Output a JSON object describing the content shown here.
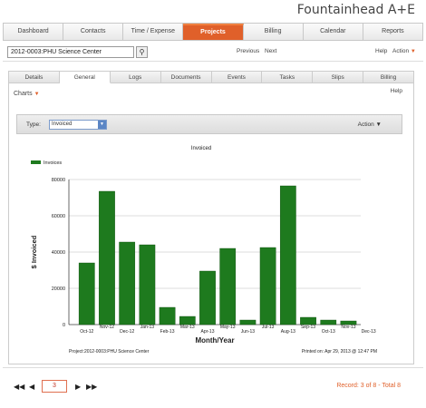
{
  "app": {
    "title": "Fountainhead A+E"
  },
  "main_tabs": [
    {
      "label": "Dashboard"
    },
    {
      "label": "Contacts"
    },
    {
      "label": "Time / Expense"
    },
    {
      "label": "Projects"
    },
    {
      "label": "Billing"
    },
    {
      "label": "Calendar"
    },
    {
      "label": "Reports"
    }
  ],
  "toolbar": {
    "project_value": "2012-0003:PHU Science Center",
    "previous_label": "Previous",
    "next_label": "Next",
    "help_label": "Help",
    "action_label": "Action"
  },
  "sub_tabs": [
    {
      "label": "Details"
    },
    {
      "label": "General"
    },
    {
      "label": "Logs"
    },
    {
      "label": "Documents"
    },
    {
      "label": "Events"
    },
    {
      "label": "Tasks"
    },
    {
      "label": "Slips"
    },
    {
      "label": "Billing"
    }
  ],
  "panel": {
    "charts_label": "Charts",
    "help_label": "Help",
    "type_label": "Type:",
    "type_value": "Invoiced",
    "action_label": "Action"
  },
  "chart_data": {
    "type": "bar",
    "title": "Invoiced",
    "legend": "Invoices",
    "xlabel": "Month/Year",
    "ylabel": "$ Invoiced",
    "ylim": [
      0,
      80000
    ],
    "yticks": [
      0,
      20000,
      40000,
      60000,
      80000
    ],
    "categories": [
      "Oct-12",
      "Nov-12",
      "Dec-12",
      "Jan-13",
      "Feb-13",
      "Mar-13",
      "Apr-13",
      "May-13",
      "Jun-13",
      "Jul-13",
      "Aug-13",
      "Sep-13",
      "Oct-13",
      "Nov-13",
      "Dec-13"
    ],
    "tick_labels_lower": [
      "Oct-12",
      "Dec-12",
      "Feb-13",
      "Apr-13",
      "Jun-13",
      "Aug-13",
      "Oct-13",
      "Dec-13"
    ],
    "tick_labels_upper": [
      "Nov-12",
      "Jan-13",
      "Mar-13",
      "May-13",
      "Jul-13",
      "Sep-13",
      "Nov-13"
    ],
    "values": [
      34000,
      73500,
      45500,
      44000,
      9500,
      4500,
      29500,
      42000,
      2500,
      42500,
      76500,
      4000,
      2500,
      2000
    ],
    "color": "#1e7a1e",
    "project_caption": "Project:2012-0003:PHU Science Center",
    "printed_caption": "Printed on:  Apr 29, 2013 @ 12:47 PM"
  },
  "footer": {
    "page_value": "3",
    "record_text": "Record: 3 of 8 - Total 8"
  }
}
